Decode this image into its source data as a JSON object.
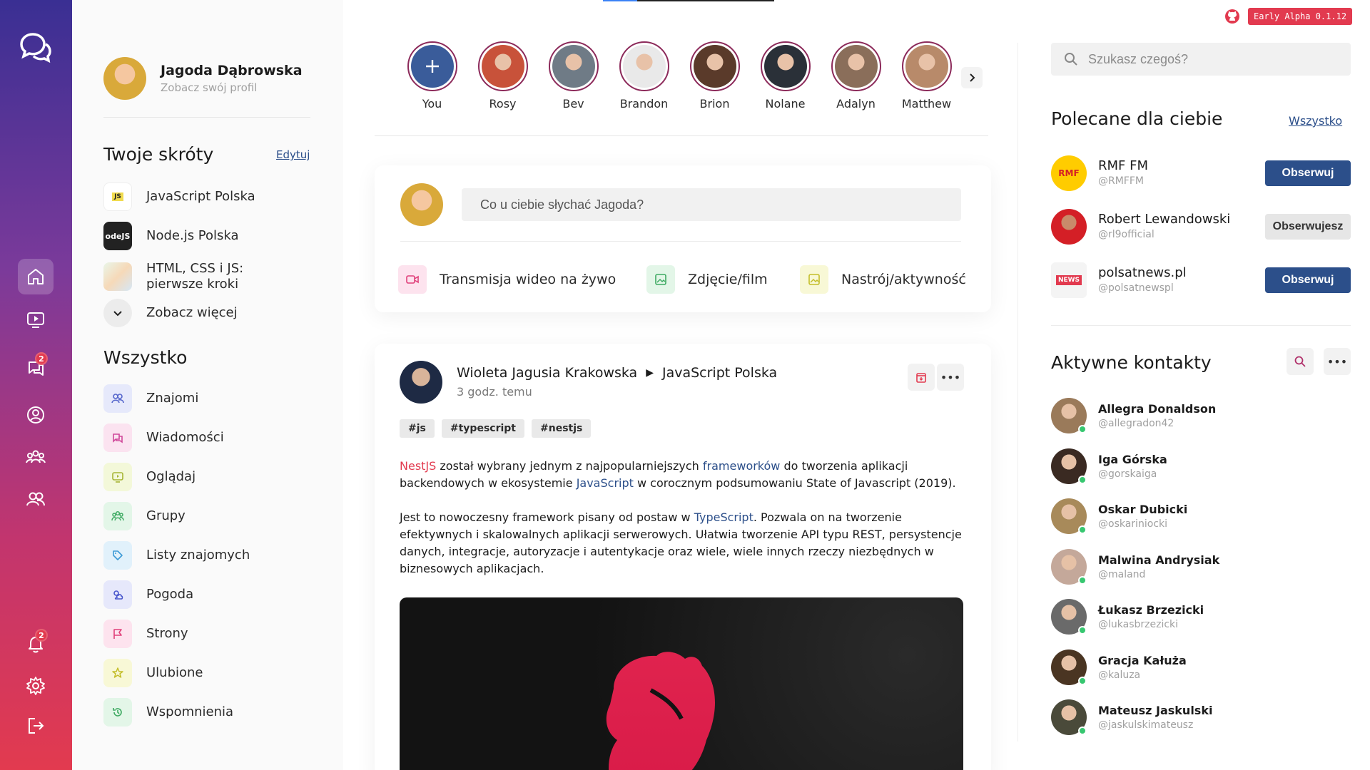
{
  "colors": {
    "accent_red": "#e23a4f",
    "accent_blue": "#2c4f8a",
    "online": "#37c770"
  },
  "nav": {
    "logo_icon": "chat-bubbles-icon",
    "items": [
      {
        "name": "home",
        "icon": "home-icon",
        "active": true
      },
      {
        "name": "watch",
        "icon": "video-icon"
      },
      {
        "name": "messages",
        "icon": "messages-icon",
        "badge": "2"
      },
      {
        "name": "profile",
        "icon": "user-circle-icon"
      },
      {
        "name": "groups",
        "icon": "groups-icon"
      },
      {
        "name": "friends",
        "icon": "friends-icon"
      }
    ],
    "bottom": [
      {
        "name": "notifications",
        "icon": "bell-icon",
        "badge": "2"
      },
      {
        "name": "settings",
        "icon": "gear-icon"
      },
      {
        "name": "logout",
        "icon": "logout-icon"
      }
    ]
  },
  "profile": {
    "name": "Jagoda Dąbrowska",
    "subtitle": "Zobacz swój profil"
  },
  "shortcuts": {
    "title": "Twoje skróty",
    "edit_label": "Edytuj",
    "items": [
      {
        "label": "JavaScript Polska",
        "icon_text": "JS"
      },
      {
        "label": "Node.js Polska",
        "icon_text": "odeJS"
      },
      {
        "label": "HTML, CSS i JS: pierwsze kroki"
      }
    ],
    "more_label": "Zobacz więcej"
  },
  "all": {
    "title": "Wszystko",
    "items": [
      {
        "label": "Znajomi",
        "icon": "friends-icon",
        "bg": "#e6e9fb",
        "fg": "#5566cc"
      },
      {
        "label": "Wiadomości",
        "icon": "messages-icon",
        "bg": "#fbe3f0",
        "fg": "#d0489a"
      },
      {
        "label": "Oglądaj",
        "icon": "video-icon",
        "bg": "#f3f8d9",
        "fg": "#a6b534"
      },
      {
        "label": "Grupy",
        "icon": "groups-icon",
        "bg": "#e3f6e8",
        "fg": "#3eaa62"
      },
      {
        "label": "Listy znajomych",
        "icon": "tag-icon",
        "bg": "#e1f1fb",
        "fg": "#3d9bd6"
      },
      {
        "label": "Pogoda",
        "icon": "weather-icon",
        "bg": "#e6e8fb",
        "fg": "#4755cc"
      },
      {
        "label": "Strony",
        "icon": "flag-icon",
        "bg": "#fde3ee",
        "fg": "#e0407a"
      },
      {
        "label": "Ulubione",
        "icon": "star-icon",
        "bg": "#f8f8d6",
        "fg": "#c4be2a"
      },
      {
        "label": "Wspomnienia",
        "icon": "history-icon",
        "bg": "#e3f6e8",
        "fg": "#3eaa62"
      }
    ]
  },
  "stories": [
    {
      "name": "You",
      "bg": "#3a5c9a",
      "add": true
    },
    {
      "name": "Rosy",
      "bg": "#c8523a"
    },
    {
      "name": "Bev",
      "bg": "#6f7b86"
    },
    {
      "name": "Brandon",
      "bg": "#e9e9e9"
    },
    {
      "name": "Brion",
      "bg": "#5a3a2a"
    },
    {
      "name": "Nolane",
      "bg": "#2a3038"
    },
    {
      "name": "Adalyn",
      "bg": "#8a6e5a"
    },
    {
      "name": "Matthew",
      "bg": "#b88a6a"
    }
  ],
  "composer": {
    "placeholder": "Co u ciebie słychać Jagoda?",
    "actions": [
      {
        "label": "Transmisja wideo na żywo",
        "icon": "video-camera-icon",
        "bg": "#fde3ee",
        "fg": "#e0407a"
      },
      {
        "label": "Zdjęcie/film",
        "icon": "image-icon",
        "bg": "#e3f6e8",
        "fg": "#3eaa62"
      },
      {
        "label": "Nastrój/aktywność",
        "icon": "mood-icon",
        "bg": "#f8f8d6",
        "fg": "#c4be2a"
      }
    ]
  },
  "post": {
    "author": "Wioleta Jagusia Krakowska",
    "group": "JavaScript Polska",
    "time": "3 godz. temu",
    "tags": [
      "#js",
      "#typescript",
      "#nestjs"
    ],
    "p1": {
      "hl1": "NestJS",
      "t1": " został wybrany jednym z najpopularniejszych ",
      "hl2": "frameworków",
      "t2": " do tworzenia aplikacji backendowych w ekosystemie ",
      "hl3": "JavaScript",
      "t3": " w corocznym podsumowaniu State of Javascript (2019)."
    },
    "p2": {
      "t1": "Jest to nowoczesny framework pisany od postaw w ",
      "hl1": "TypeScript",
      "t2": ". Pozwala on na tworzenie efektywnych i skalowalnych aplikacji serwerowych. Ułatwia tworzenie API typu REST, persystencje danych, integracje, autoryzacje i autentykacje oraz wiele, wiele innych rzeczy niezbędnych w biznesowych aplikacjach."
    }
  },
  "topbar": {
    "badge": "Early Alpha 0.1.12",
    "github_icon": "github-icon"
  },
  "search": {
    "placeholder": "Szukasz czegoś?"
  },
  "recommended": {
    "title": "Polecane dla ciebie",
    "all_label": "Wszystko",
    "items": [
      {
        "name": "RMF FM",
        "handle": "@RMFFM",
        "button": "Obserwuj",
        "following": false,
        "logo": "RMF"
      },
      {
        "name": "Robert Lewandowski",
        "handle": "@rl9official",
        "button": "Obserwujesz",
        "following": true
      },
      {
        "name": "polsatnews.pl",
        "handle": "@polsatnewspl",
        "button": "Obserwuj",
        "following": false,
        "logo": "NEWS"
      }
    ]
  },
  "contacts": {
    "title": "Aktywne kontakty",
    "items": [
      {
        "name": "Allegra Donaldson",
        "handle": "@allegradon42",
        "bg": "#9a7a5a"
      },
      {
        "name": "Iga Górska",
        "handle": "@gorskaiga",
        "bg": "#3a2a22"
      },
      {
        "name": "Oskar Dubicki",
        "handle": "@oskariniocki",
        "bg": "#a88a5a"
      },
      {
        "name": "Malwina Andrysiak",
        "handle": "@maland",
        "bg": "#c4a89a"
      },
      {
        "name": "Łukasz Brzezicki",
        "handle": "@lukasbrzezicki",
        "bg": "#6a6a6a"
      },
      {
        "name": "Gracja Kałuża",
        "handle": "@kaluza",
        "bg": "#4a3522"
      },
      {
        "name": "Mateusz Jaskulski",
        "handle": "@jaskulskimateusz",
        "bg": "#4a4a3a"
      }
    ]
  }
}
